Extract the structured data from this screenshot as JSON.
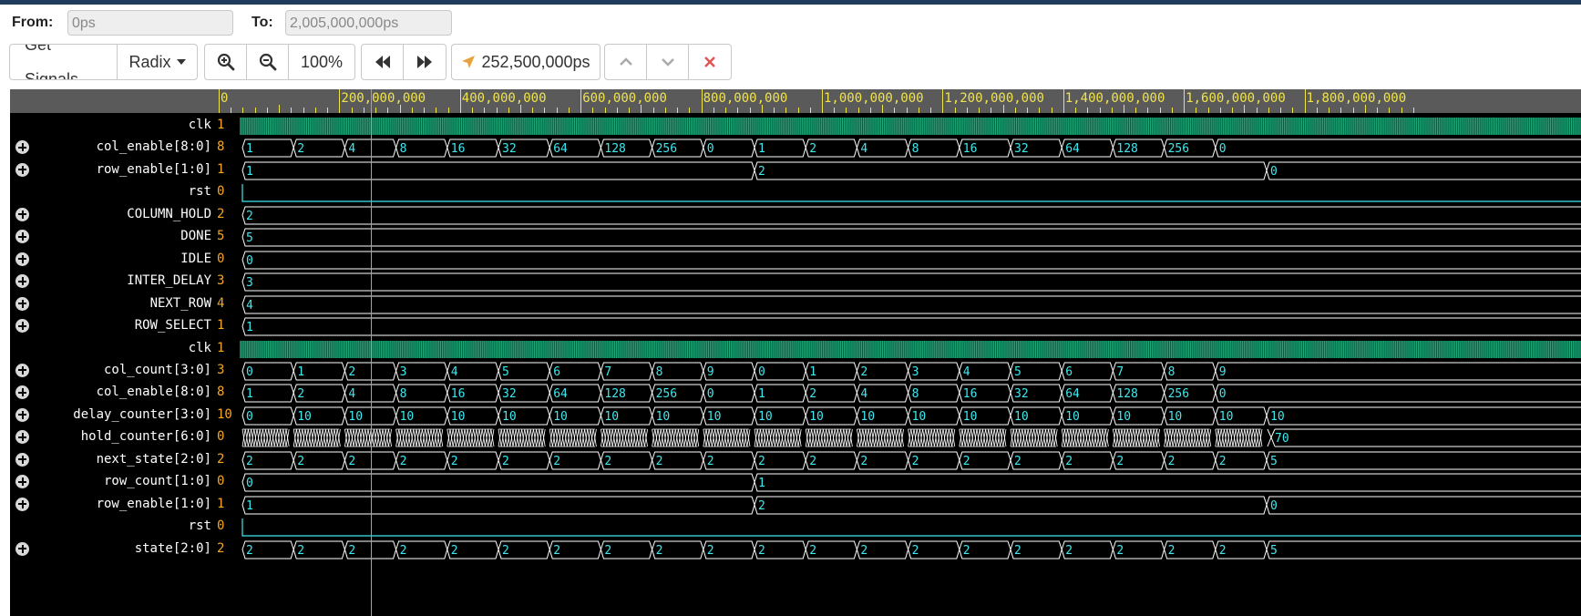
{
  "toolbar": {
    "from_label": "From:",
    "from_value": "0ps",
    "to_label": "To:",
    "to_value": "2,005,000,000ps",
    "get_signals_label": "Get Signals",
    "radix_label": "Radix",
    "zoom_in_icon": "zoom-in-icon",
    "zoom_out_icon": "zoom-out-icon",
    "zoom_level": "100%",
    "rewind_icon": "rewind-icon",
    "fast_forward_icon": "fast-forward-icon",
    "cursor_time": "252,500,000ps",
    "cursor_icon": "cursor-arrow-icon",
    "up_icon": "chevron-up-icon",
    "down_icon": "chevron-down-icon",
    "delete_icon": "close-icon"
  },
  "colors": {
    "ruler_bg": "#5a5a5a",
    "ruler_text": "#f0e34d",
    "wave_line": "#ffffff",
    "wave_text": "#3ee8f0",
    "clock_fill": "#1fa87a",
    "signal_value": "#f5a623",
    "cursor": "#c8a040",
    "delete": "#e05555"
  },
  "timeline": {
    "start": 0,
    "end": 2005000000,
    "cursor_time": 252500000,
    "tick_labels": [
      "0",
      "200,000,000",
      "400,000,000",
      "600,000,000",
      "800,000,000",
      "1,000,000,000",
      "1,200,000,000",
      "1,400,000,000",
      "1,600,000,000",
      "1,800,000,000"
    ]
  },
  "signals": [
    {
      "name": "clk",
      "value": "1",
      "type": "clock",
      "expandable": false
    },
    {
      "name": "col_enable[8:0]",
      "value": "8",
      "type": "bus",
      "expandable": true,
      "segments": [
        [
          0,
          "1"
        ],
        [
          84,
          "2"
        ],
        [
          168,
          "4"
        ],
        [
          252,
          "8"
        ],
        [
          336,
          "16"
        ],
        [
          420,
          "32"
        ],
        [
          504,
          "64"
        ],
        [
          588,
          "128"
        ],
        [
          672,
          "256"
        ],
        [
          756,
          "0"
        ],
        [
          840,
          "1"
        ],
        [
          924,
          "2"
        ],
        [
          1008,
          "4"
        ],
        [
          1092,
          "8"
        ],
        [
          1176,
          "16"
        ],
        [
          1260,
          "32"
        ],
        [
          1344,
          "64"
        ],
        [
          1428,
          "128"
        ],
        [
          1512,
          "256"
        ],
        [
          1596,
          "0"
        ]
      ]
    },
    {
      "name": "row_enable[1:0]",
      "value": "1",
      "type": "bus",
      "expandable": true,
      "segments": [
        [
          0,
          "1"
        ],
        [
          840,
          "2"
        ],
        [
          1680,
          "0"
        ]
      ]
    },
    {
      "name": "rst",
      "value": "0",
      "type": "bit",
      "expandable": false
    },
    {
      "name": "COLUMN_HOLD",
      "value": "2",
      "type": "bus",
      "expandable": true,
      "segments": [
        [
          0,
          "2"
        ]
      ]
    },
    {
      "name": "DONE",
      "value": "5",
      "type": "bus",
      "expandable": true,
      "segments": [
        [
          0,
          "5"
        ]
      ]
    },
    {
      "name": "IDLE",
      "value": "0",
      "type": "bus",
      "expandable": true,
      "segments": [
        [
          0,
          "0"
        ]
      ]
    },
    {
      "name": "INTER_DELAY",
      "value": "3",
      "type": "bus",
      "expandable": true,
      "segments": [
        [
          0,
          "3"
        ]
      ]
    },
    {
      "name": "NEXT_ROW",
      "value": "4",
      "type": "bus",
      "expandable": true,
      "segments": [
        [
          0,
          "4"
        ]
      ]
    },
    {
      "name": "ROW_SELECT",
      "value": "1",
      "type": "bus",
      "expandable": true,
      "segments": [
        [
          0,
          "1"
        ]
      ]
    },
    {
      "name": "clk",
      "value": "1",
      "type": "clock",
      "expandable": false
    },
    {
      "name": "col_count[3:0]",
      "value": "3",
      "type": "bus",
      "expandable": true,
      "segments": [
        [
          0,
          "0"
        ],
        [
          84,
          "1"
        ],
        [
          168,
          "2"
        ],
        [
          252,
          "3"
        ],
        [
          336,
          "4"
        ],
        [
          420,
          "5"
        ],
        [
          504,
          "6"
        ],
        [
          588,
          "7"
        ],
        [
          672,
          "8"
        ],
        [
          756,
          "9"
        ],
        [
          840,
          "0"
        ],
        [
          924,
          "1"
        ],
        [
          1008,
          "2"
        ],
        [
          1092,
          "3"
        ],
        [
          1176,
          "4"
        ],
        [
          1260,
          "5"
        ],
        [
          1344,
          "6"
        ],
        [
          1428,
          "7"
        ],
        [
          1512,
          "8"
        ],
        [
          1596,
          "9"
        ]
      ]
    },
    {
      "name": "col_enable[8:0]",
      "value": "8",
      "type": "bus",
      "expandable": true,
      "segments": [
        [
          0,
          "1"
        ],
        [
          84,
          "2"
        ],
        [
          168,
          "4"
        ],
        [
          252,
          "8"
        ],
        [
          336,
          "16"
        ],
        [
          420,
          "32"
        ],
        [
          504,
          "64"
        ],
        [
          588,
          "128"
        ],
        [
          672,
          "256"
        ],
        [
          756,
          "0"
        ],
        [
          840,
          "1"
        ],
        [
          924,
          "2"
        ],
        [
          1008,
          "4"
        ],
        [
          1092,
          "8"
        ],
        [
          1176,
          "16"
        ],
        [
          1260,
          "32"
        ],
        [
          1344,
          "64"
        ],
        [
          1428,
          "128"
        ],
        [
          1512,
          "256"
        ],
        [
          1596,
          "0"
        ]
      ]
    },
    {
      "name": "delay_counter[3:0]",
      "value": "10",
      "type": "bus",
      "expandable": true,
      "segments": [
        [
          0,
          "0"
        ],
        [
          84,
          "10"
        ],
        [
          168,
          "10"
        ],
        [
          252,
          "10"
        ],
        [
          336,
          "10"
        ],
        [
          420,
          "10"
        ],
        [
          504,
          "10"
        ],
        [
          588,
          "10"
        ],
        [
          672,
          "10"
        ],
        [
          756,
          "10"
        ],
        [
          840,
          "10"
        ],
        [
          924,
          "10"
        ],
        [
          1008,
          "10"
        ],
        [
          1092,
          "10"
        ],
        [
          1176,
          "10"
        ],
        [
          1260,
          "10"
        ],
        [
          1344,
          "10"
        ],
        [
          1428,
          "10"
        ],
        [
          1512,
          "10"
        ],
        [
          1596,
          "10"
        ],
        [
          1680,
          "10"
        ]
      ]
    },
    {
      "name": "hold_counter[6:0]",
      "value": "0",
      "type": "dense",
      "expandable": true,
      "end_value": "70"
    },
    {
      "name": "next_state[2:0]",
      "value": "2",
      "type": "bus",
      "expandable": true,
      "segments": [
        [
          0,
          "2"
        ],
        [
          84,
          "2"
        ],
        [
          168,
          "2"
        ],
        [
          252,
          "2"
        ],
        [
          336,
          "2"
        ],
        [
          420,
          "2"
        ],
        [
          504,
          "2"
        ],
        [
          588,
          "2"
        ],
        [
          672,
          "2"
        ],
        [
          756,
          "2"
        ],
        [
          840,
          "2"
        ],
        [
          924,
          "2"
        ],
        [
          1008,
          "2"
        ],
        [
          1092,
          "2"
        ],
        [
          1176,
          "2"
        ],
        [
          1260,
          "2"
        ],
        [
          1344,
          "2"
        ],
        [
          1428,
          "2"
        ],
        [
          1512,
          "2"
        ],
        [
          1596,
          "2"
        ],
        [
          1680,
          "5"
        ]
      ]
    },
    {
      "name": "row_count[1:0]",
      "value": "0",
      "type": "bus",
      "expandable": true,
      "segments": [
        [
          0,
          "0"
        ],
        [
          840,
          "1"
        ]
      ]
    },
    {
      "name": "row_enable[1:0]",
      "value": "1",
      "type": "bus",
      "expandable": true,
      "segments": [
        [
          0,
          "1"
        ],
        [
          840,
          "2"
        ],
        [
          1680,
          "0"
        ]
      ]
    },
    {
      "name": "rst",
      "value": "0",
      "type": "bit",
      "expandable": false
    },
    {
      "name": "state[2:0]",
      "value": "2",
      "type": "bus",
      "expandable": true,
      "segments": [
        [
          0,
          "2"
        ],
        [
          84,
          "2"
        ],
        [
          168,
          "2"
        ],
        [
          252,
          "2"
        ],
        [
          336,
          "2"
        ],
        [
          420,
          "2"
        ],
        [
          504,
          "2"
        ],
        [
          588,
          "2"
        ],
        [
          672,
          "2"
        ],
        [
          756,
          "2"
        ],
        [
          840,
          "2"
        ],
        [
          924,
          "2"
        ],
        [
          1008,
          "2"
        ],
        [
          1092,
          "2"
        ],
        [
          1176,
          "2"
        ],
        [
          1260,
          "2"
        ],
        [
          1344,
          "2"
        ],
        [
          1428,
          "2"
        ],
        [
          1512,
          "2"
        ],
        [
          1596,
          "2"
        ],
        [
          1680,
          "5"
        ]
      ]
    }
  ]
}
